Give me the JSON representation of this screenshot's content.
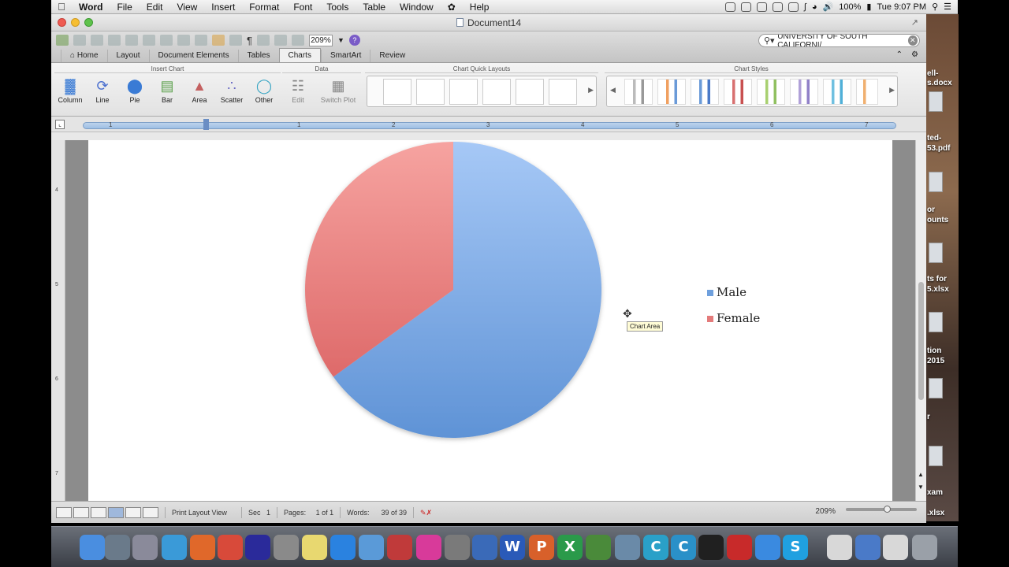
{
  "menubar": {
    "app_name": "Word",
    "items": [
      "File",
      "Edit",
      "View",
      "Insert",
      "Format",
      "Font",
      "Tools",
      "Table",
      "Window",
      "Help"
    ],
    "battery": "100%",
    "clock": "Tue 9:07 PM"
  },
  "window": {
    "title": "Document14"
  },
  "toolbar": {
    "zoom": "209%",
    "search_value": "UNIVERSITY OF SOUTH CALIFORNI/"
  },
  "tabs": [
    {
      "label": "Home",
      "active": false
    },
    {
      "label": "Layout",
      "active": false
    },
    {
      "label": "Document Elements",
      "active": false
    },
    {
      "label": "Tables",
      "active": false
    },
    {
      "label": "Charts",
      "active": true
    },
    {
      "label": "SmartArt",
      "active": false
    },
    {
      "label": "Review",
      "active": false
    }
  ],
  "ribbon": {
    "insert_chart": {
      "title": "Insert Chart",
      "buttons": [
        {
          "label": "Column",
          "icon": "column-chart-icon"
        },
        {
          "label": "Line",
          "icon": "line-chart-icon"
        },
        {
          "label": "Pie",
          "icon": "pie-chart-icon"
        },
        {
          "label": "Bar",
          "icon": "bar-chart-icon"
        },
        {
          "label": "Area",
          "icon": "area-chart-icon"
        },
        {
          "label": "Scatter",
          "icon": "scatter-chart-icon"
        },
        {
          "label": "Other",
          "icon": "other-chart-icon"
        }
      ]
    },
    "data": {
      "title": "Data",
      "buttons": [
        {
          "label": "Edit",
          "icon": "edit-data-icon"
        },
        {
          "label": "Switch Plot",
          "icon": "switch-plot-icon"
        }
      ]
    },
    "quick_layouts": {
      "title": "Chart Quick Layouts"
    },
    "chart_styles": {
      "title": "Chart Styles"
    }
  },
  "ruler": {
    "marks": [
      "1",
      "1",
      "2",
      "3",
      "4",
      "5",
      "6",
      "7"
    ]
  },
  "vruler": {
    "marks": [
      "4",
      "5",
      "6",
      "7"
    ]
  },
  "chart_data": {
    "type": "pie",
    "categories": [
      "Male",
      "Female"
    ],
    "values": [
      65,
      35
    ],
    "colors": [
      "#6fa0dd",
      "#e47b7b"
    ],
    "legend_position": "right"
  },
  "tooltip": "Chart Area",
  "statusbar": {
    "view": "Print Layout View",
    "sec_label": "Sec",
    "sec_value": "1",
    "pages_label": "Pages:",
    "pages_value": "1 of 1",
    "words_label": "Words:",
    "words_value": "39 of 39",
    "zoom": "209%"
  },
  "desktop": {
    "files": [
      "ell-",
      "s.docx",
      "ted-",
      "53.pdf",
      "or",
      "ounts",
      "ts for",
      "5.xlsx",
      "tion",
      "2015",
      "r",
      "xam",
      ".xlsx"
    ]
  },
  "dock": {
    "icons": [
      "finder-icon",
      "preview-icon",
      "launchpad-icon",
      "safari-icon",
      "firefox-icon",
      "chrome-icon",
      "audacity-icon",
      "facetime-icon",
      "stickies-icon",
      "dropbox-icon",
      "itunes-helper-icon",
      "photobooth-icon",
      "itunes-icon",
      "system-preferences-icon",
      "calculator-icon",
      "word-icon",
      "powerpoint-icon",
      "excel-icon",
      "globe-icon",
      "colloquy-icon",
      "c-app-icon-1",
      "c-app-icon-2",
      "terminal-icon",
      "acrobat-icon",
      "messages-icon",
      "skype-icon",
      "documents-icon",
      "calendar-icon",
      "excel-doc-icon",
      "trash-icon"
    ]
  }
}
